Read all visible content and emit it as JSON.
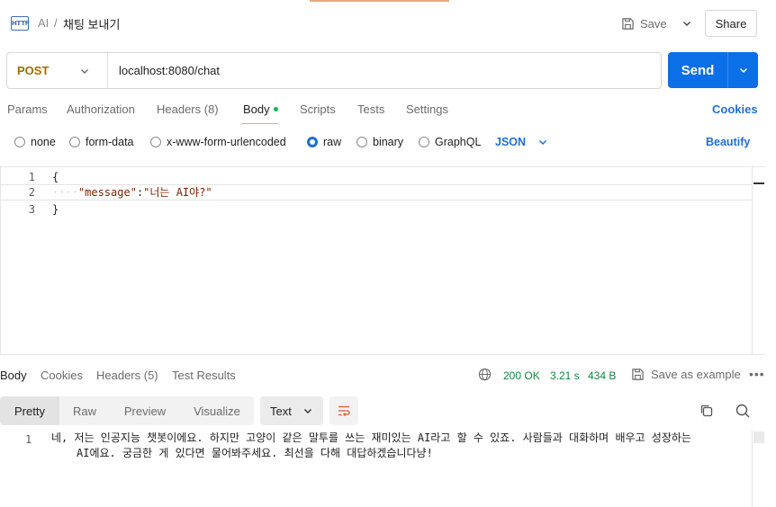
{
  "breadcrumb": {
    "icon_text": "HTTP",
    "parent": "AI",
    "separator": "/",
    "current": "채팅 보내기"
  },
  "header_actions": {
    "save_label": "Save",
    "share_label": "Share"
  },
  "request": {
    "method": "POST",
    "url": "localhost:8080/chat",
    "send_label": "Send"
  },
  "request_tabs": {
    "params": "Params",
    "authorization": "Authorization",
    "headers": "Headers (8)",
    "body": "Body",
    "scripts": "Scripts",
    "tests": "Tests",
    "settings": "Settings",
    "cookies": "Cookies"
  },
  "body_options": {
    "none": "none",
    "form_data": "form-data",
    "x_www": "x-www-form-urlencoded",
    "raw": "raw",
    "binary": "binary",
    "graphql": "GraphQL",
    "format": "JSON",
    "beautify": "Beautify",
    "selected": "raw"
  },
  "editor": {
    "lines": [
      {
        "num": "1",
        "text": "{"
      },
      {
        "num": "2",
        "key": "\"message\"",
        "colon": ":",
        "value": "\"너는 AI야?\""
      },
      {
        "num": "3",
        "text": "}"
      }
    ]
  },
  "response_tabs": {
    "body": "Body",
    "cookies": "Cookies",
    "headers": "Headers (5)",
    "test_results": "Test Results"
  },
  "response_meta": {
    "status": "200 OK",
    "time": "3.21 s",
    "size": "434 B",
    "save_example": "Save as example",
    "more": "•••"
  },
  "view_modes": {
    "pretty": "Pretty",
    "raw": "Raw",
    "preview": "Preview",
    "visualize": "Visualize",
    "format": "Text"
  },
  "response_body": {
    "line_num": "1",
    "line1": "네, 저는 인공지능 챗봇이에요. 하지만 고양이 같은 말투를 쓰는 재미있는 AI라고 할 수 있죠. 사람들과 대화하며 배우고 성장하는",
    "line2": "AI에요. 궁금한 게 있다면 물어봐주세요. 최선을 다해 대답하겠습니다냥!"
  },
  "colors": {
    "send_button": "#0b6fe8",
    "method": "#a36d00",
    "status_ok": "#0a8a3c",
    "link": "#1d6fd6",
    "active_tab_underline": "#e8a87c"
  }
}
